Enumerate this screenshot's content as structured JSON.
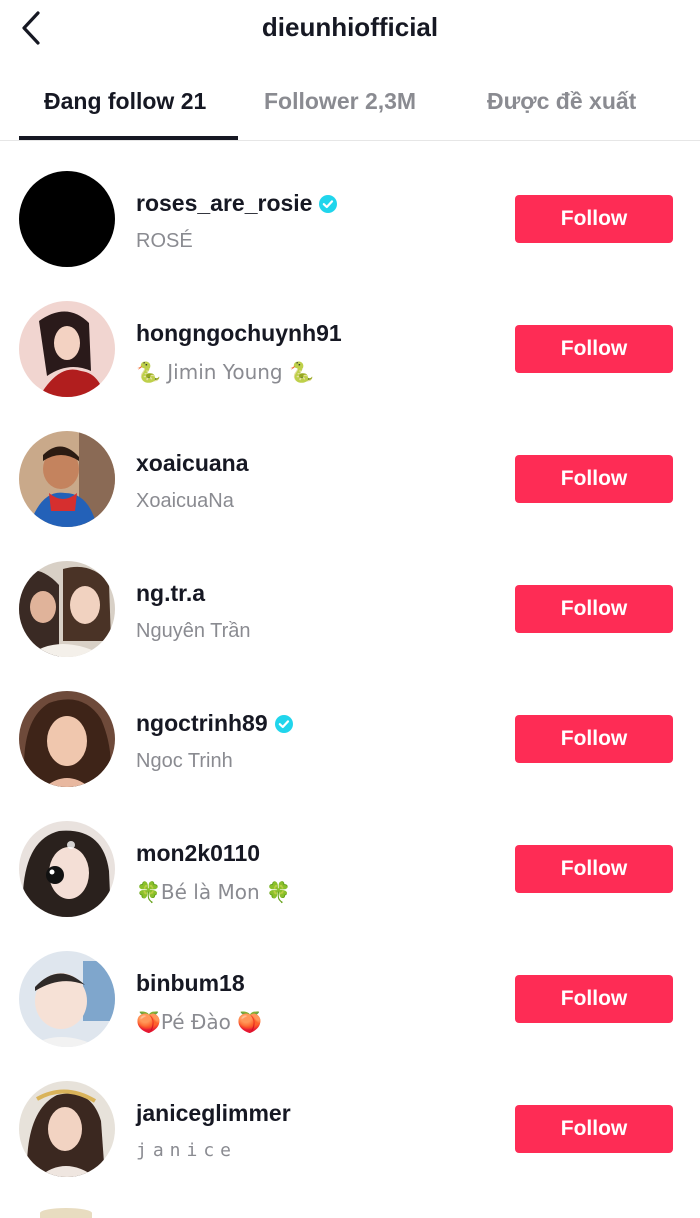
{
  "header": {
    "title": "dieunhiofficial",
    "back_icon": "chevron-left-icon"
  },
  "tabs": [
    {
      "label": "Đang follow 21",
      "active": true
    },
    {
      "label": "Follower 2,3M",
      "active": false
    },
    {
      "label": "Được đề xuất",
      "active": false
    }
  ],
  "colors": {
    "accent": "#fe2c55",
    "verified": "#20d5ec",
    "muted": "#8a8b91",
    "text": "#161823"
  },
  "users": [
    {
      "username": "roses_are_rosie",
      "verified": true,
      "nickname": "ROSÉ",
      "follow_label": "Follow"
    },
    {
      "username": "hongngochuynh91",
      "verified": false,
      "nickname": "🐍  Jimin Young 🐍",
      "follow_label": "Follow"
    },
    {
      "username": "xoaicuana",
      "verified": false,
      "nickname": "XoaicuaNa",
      "follow_label": "Follow"
    },
    {
      "username": "ng.tr.a",
      "verified": false,
      "nickname": "Nguyên Trần",
      "follow_label": "Follow"
    },
    {
      "username": "ngoctrinh89",
      "verified": true,
      "nickname": "Ngoc Trinh",
      "follow_label": "Follow"
    },
    {
      "username": "mon2k0110",
      "verified": false,
      "nickname": "🍀Bé là Mon 🍀",
      "follow_label": "Follow"
    },
    {
      "username": "binbum18",
      "verified": false,
      "nickname": "🍑Pé Đào 🍑",
      "follow_label": "Follow"
    },
    {
      "username": "janiceglimmer",
      "verified": false,
      "nickname": "janice",
      "follow_label": "Follow"
    }
  ]
}
